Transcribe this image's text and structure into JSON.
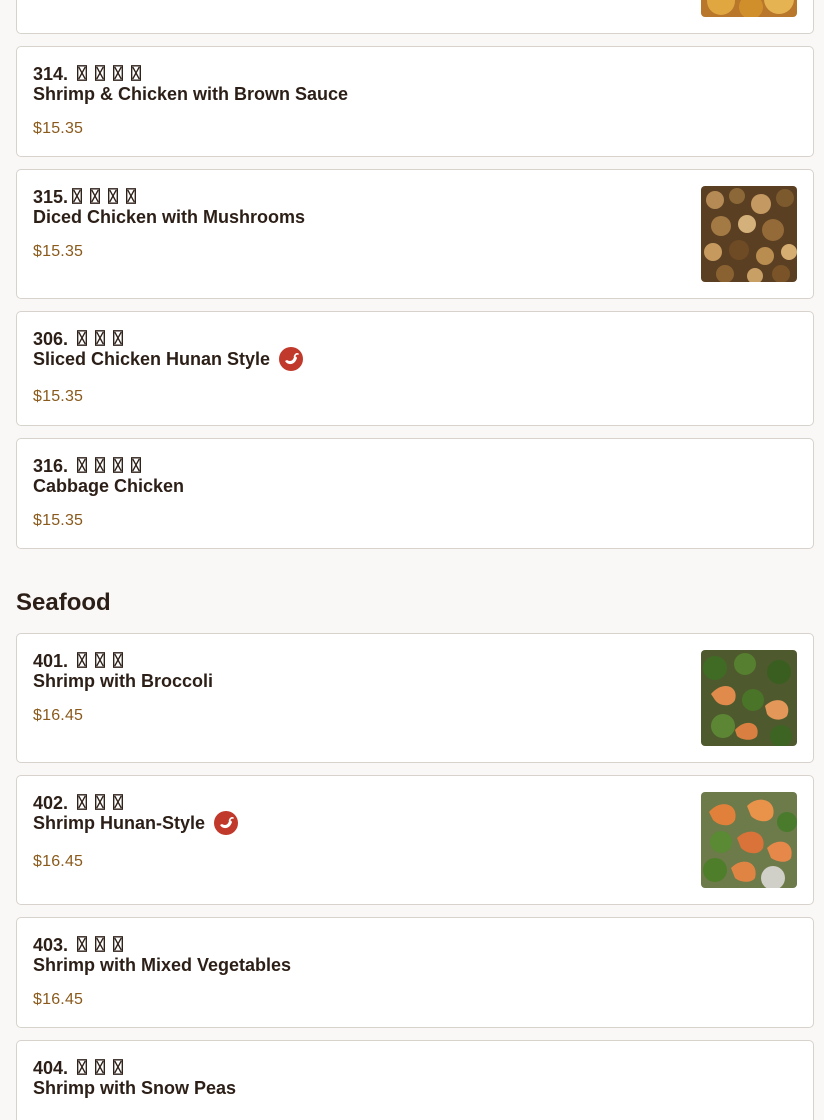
{
  "sections": [
    {
      "items": [
        {
          "cn": "314. 〿〿〿〿",
          "en": "Shrimp & Chicken with Brown Sauce",
          "price": "$15.35"
        },
        {
          "cn": "315.〿〿〿〿",
          "en": "Diced Chicken with Mushrooms",
          "price": "$15.35",
          "image": "diced-chicken-mushrooms-photo"
        },
        {
          "cn": "306. 〿〿〿",
          "en": "Sliced Chicken Hunan Style",
          "price": "$15.35",
          "spicy": true
        },
        {
          "cn": "316. 〿〿〿〿",
          "en": "Cabbage Chicken",
          "price": "$15.35"
        }
      ]
    },
    {
      "title": "Seafood",
      "items": [
        {
          "cn": "401. 〿〿〿",
          "en": "Shrimp with Broccoli",
          "price": "$16.45",
          "image": "shrimp-broccoli-photo"
        },
        {
          "cn": "402. 〿〿〿",
          "en": "Shrimp Hunan-Style",
          "price": "$16.45",
          "image": "shrimp-hunan-photo",
          "spicy": true
        },
        {
          "cn": "403. 〿〿〿",
          "en": "Shrimp with Mixed Vegetables",
          "price": "$16.45"
        },
        {
          "cn": "404. 〿〿〿",
          "en": "Shrimp with Snow Peas"
        }
      ]
    }
  ],
  "icons": {
    "spicy": "chili-pepper-icon"
  },
  "colors": {
    "price": "#8a5a1c",
    "spicy_badge": "#c0392b",
    "card_border": "#d8d2cc",
    "background": "#faf8f6"
  }
}
